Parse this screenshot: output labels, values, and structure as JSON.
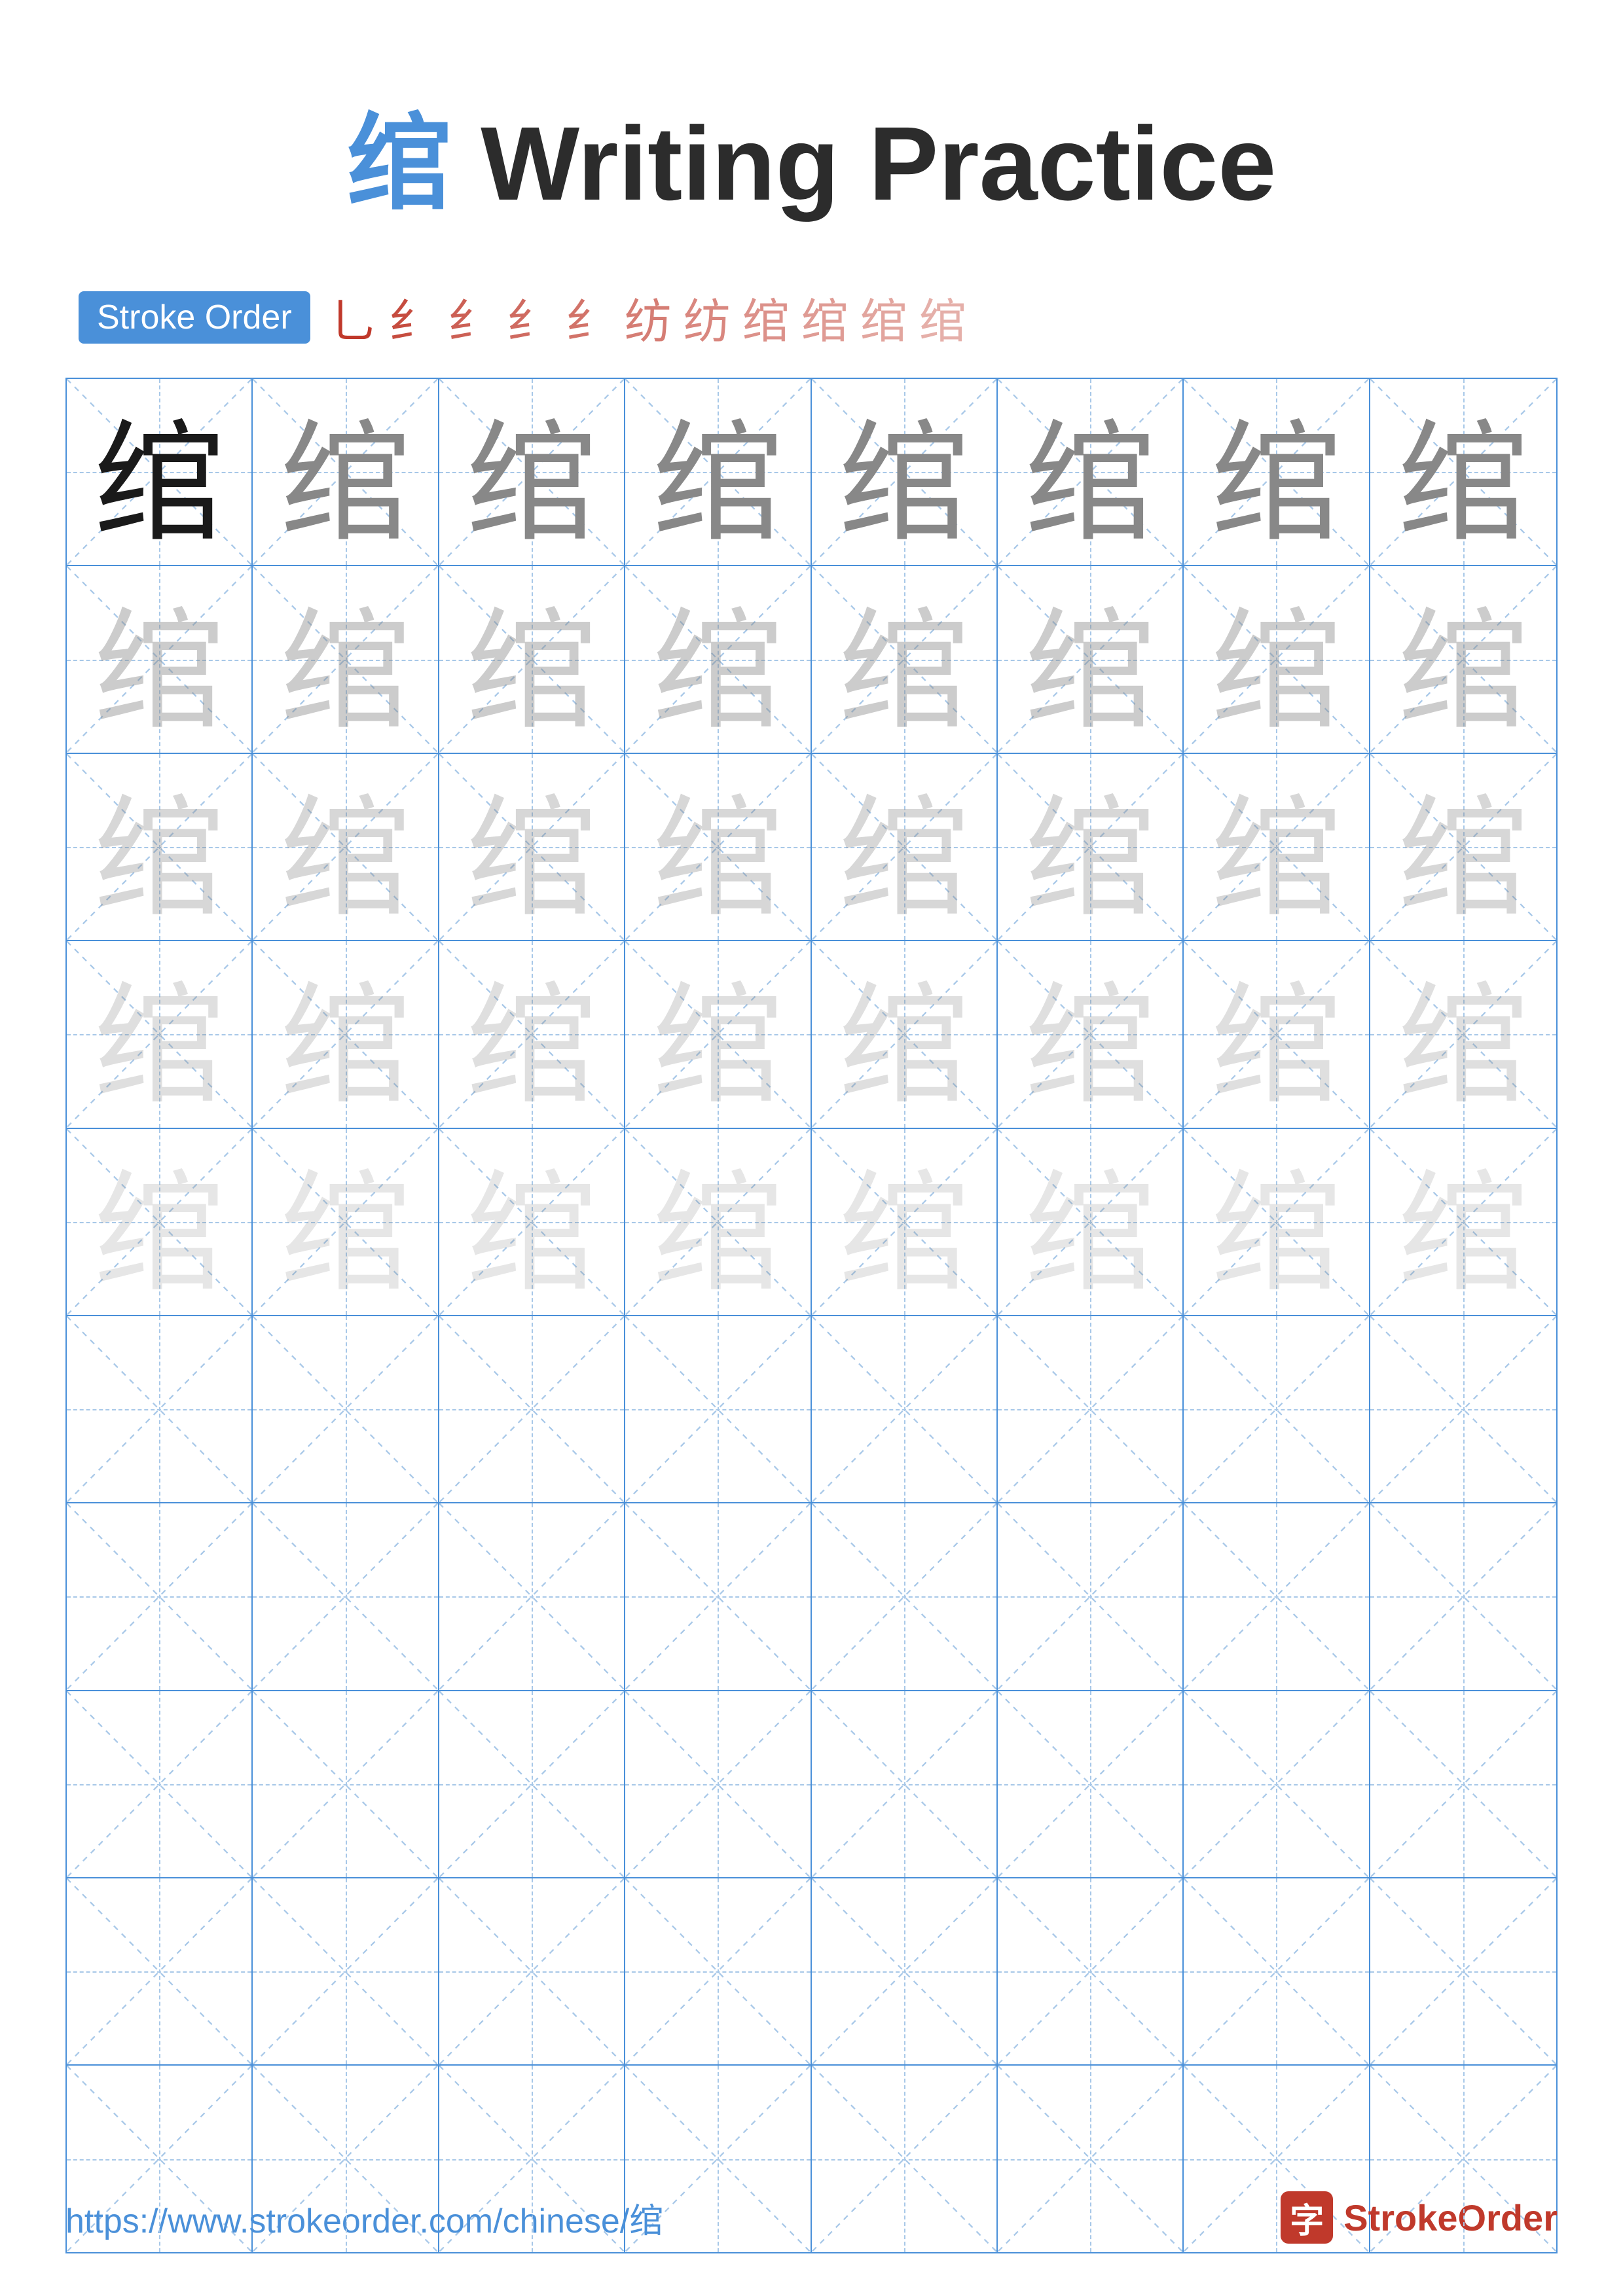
{
  "title": {
    "char": "绾",
    "text": " Writing Practice"
  },
  "stroke_order": {
    "badge_label": "Stroke Order",
    "strokes": [
      "乚",
      "纟",
      "纟",
      "纟́",
      "纟̀",
      "纺",
      "纺",
      "绾",
      "绾",
      "绾",
      "绾"
    ]
  },
  "grid": {
    "rows": 10,
    "cols": 8,
    "char": "绾",
    "practice_rows": 5,
    "empty_rows": 5
  },
  "footer": {
    "url": "https://www.strokeorder.com/chinese/绾",
    "brand_char": "字",
    "brand_name": "StrokeOrder"
  }
}
